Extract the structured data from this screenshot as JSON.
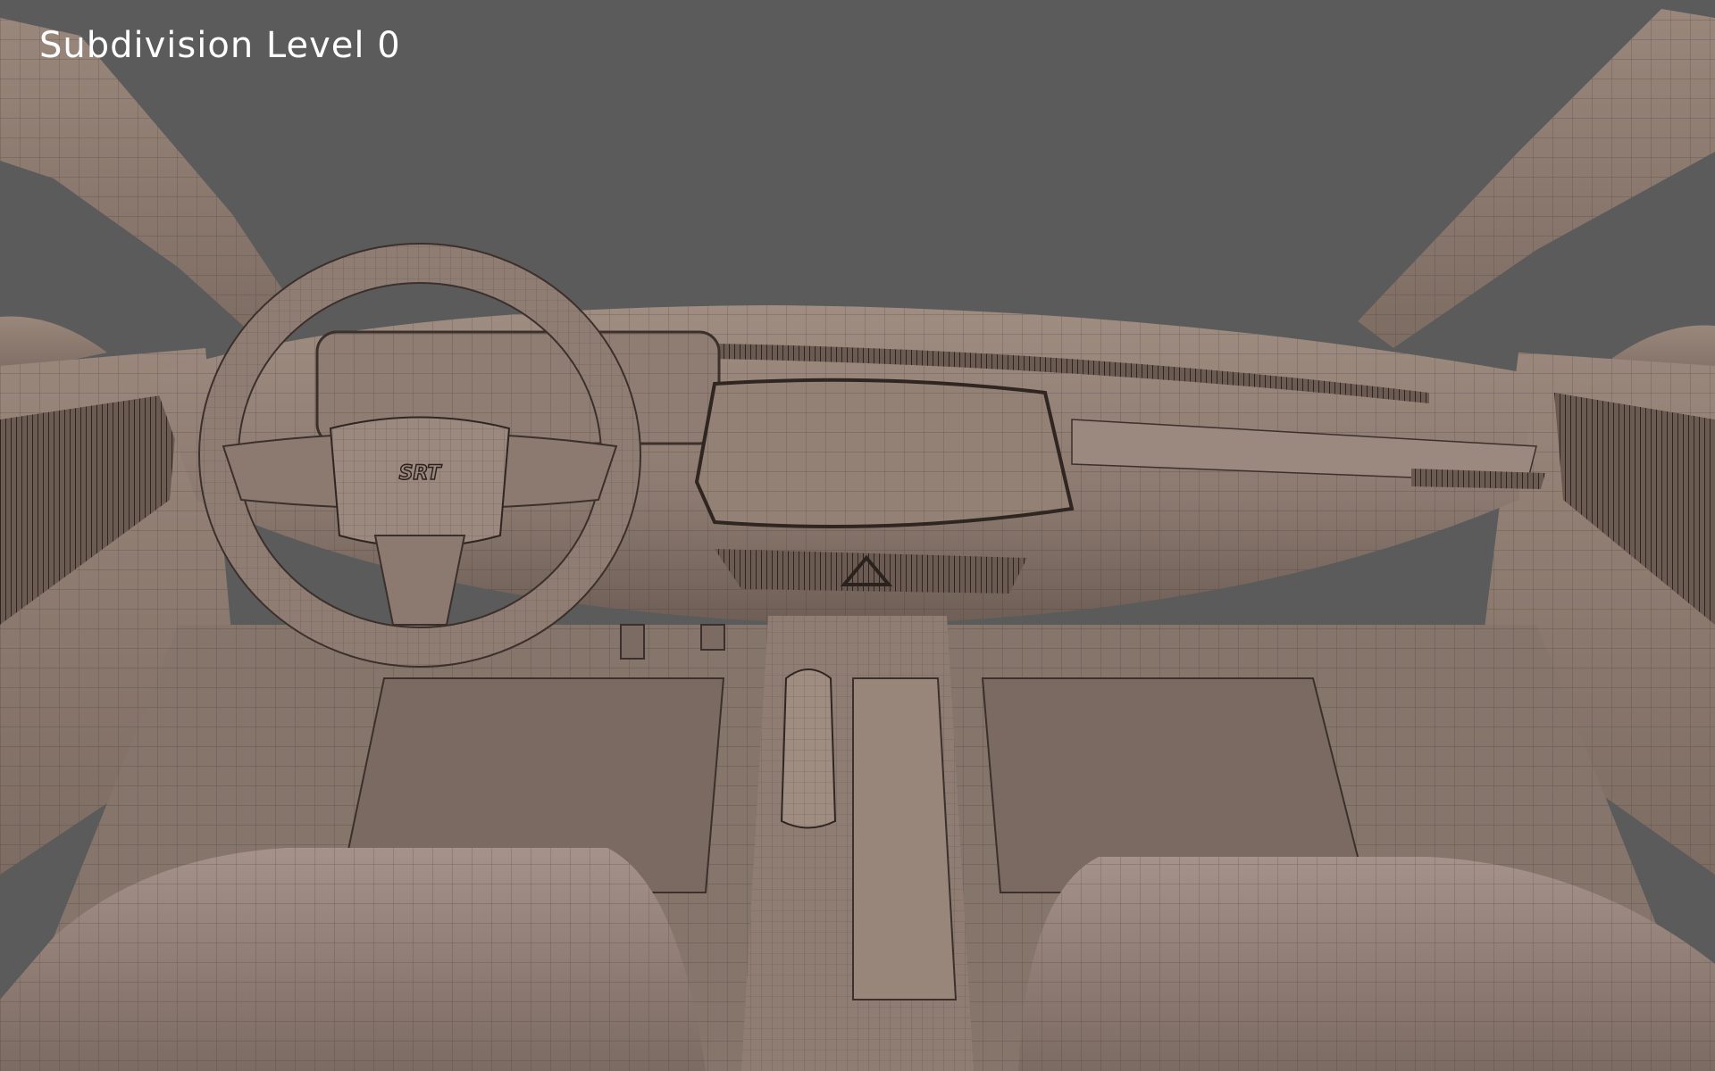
{
  "viewport": {
    "title": "Subdivision Level 0",
    "background": "#5b5b5b",
    "clay": "#8e7c72",
    "clay_light": "#a39086",
    "clay_dark": "#6f5f56",
    "wire": "#3b302b"
  },
  "steering_wheel": {
    "badge": "SRT"
  }
}
